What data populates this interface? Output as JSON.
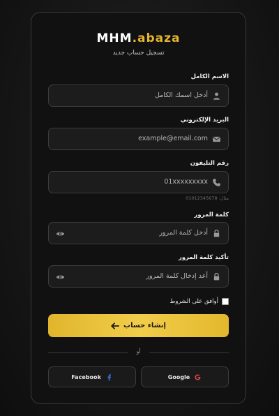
{
  "brand": {
    "name_main": "MHM",
    "name_accent": ".abaza"
  },
  "subtitle": "تسجيل حساب جديد",
  "fields": {
    "fullname": {
      "label": "الاسم الكامل",
      "placeholder": "أدخل اسمك الكامل",
      "icon": "user-icon"
    },
    "email": {
      "label": "البريد الإلكتروني",
      "placeholder": "example@email.com",
      "icon": "envelope-icon"
    },
    "phone": {
      "label": "رقم التليفون",
      "placeholder": "01xxxxxxxxx",
      "hint": "مثال: 01012345678",
      "icon": "phone-icon"
    },
    "password": {
      "label": "كلمة المرور",
      "placeholder": "أدخل كلمة المرور",
      "icon": "lock-icon"
    },
    "confirm_password": {
      "label": "تأكيد كلمة المرور",
      "placeholder": "أعد إدخال كلمة المرور",
      "icon": "lock-icon"
    }
  },
  "terms": {
    "label": "أوافق على الشروط",
    "checked": false
  },
  "submit": {
    "label": "إنشاء حساب"
  },
  "divider_text": "أو",
  "social": {
    "google": "Google",
    "facebook": "Facebook"
  },
  "colors": {
    "accent": "#e6b62e",
    "google_red": "#e04b4b",
    "facebook_blue": "#3b7bf5"
  }
}
